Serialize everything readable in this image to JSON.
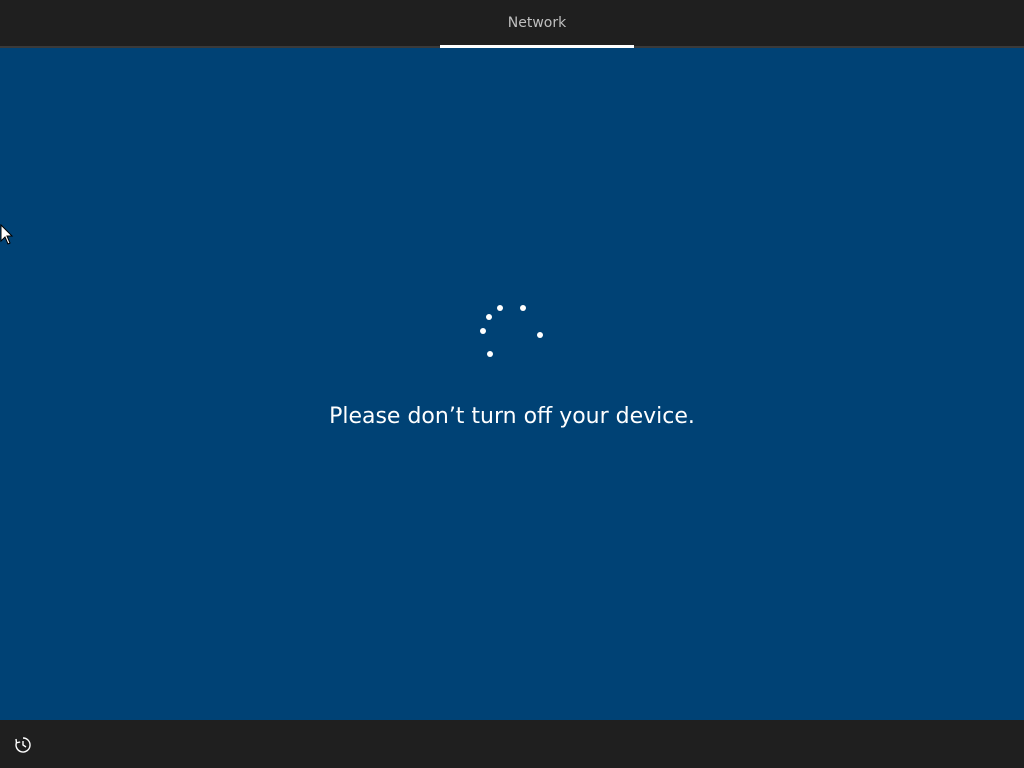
{
  "header": {
    "active_tab_label": "Network"
  },
  "main": {
    "status_message": "Please don’t turn off your device.",
    "spinner_icon": "loading-dots-icon"
  },
  "footer": {
    "ease_of_access_icon": "ease-of-access-icon"
  },
  "colors": {
    "background": "#004275",
    "bar": "#1f1f1f",
    "text": "#ffffff"
  }
}
